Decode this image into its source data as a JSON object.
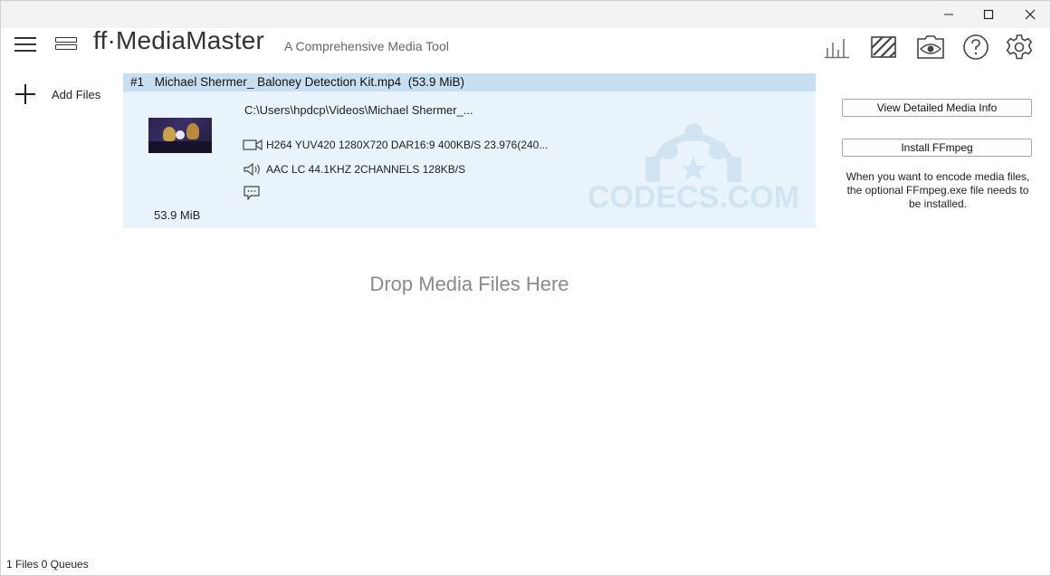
{
  "window": {
    "minimize_glyph": "—",
    "maximize_glyph": "☐",
    "close_glyph": "✕"
  },
  "header": {
    "app_title": "ff·MediaMaster",
    "app_subtitle": "A Comprehensive Media Tool",
    "icons": [
      "hamburger-menu-icon",
      "queue-stack-icon",
      "bar-chart-icon",
      "stripes-icon",
      "preview-eye-icon",
      "help-icon",
      "settings-gear-icon"
    ]
  },
  "sidebar": {
    "add_files_label": "Add Files"
  },
  "media_item": {
    "index": "#1",
    "filename": "Michael Shermer_ Baloney Detection Kit.mp4",
    "size_header": "(53.9 MiB)",
    "path": "C:\\Users\\hpdcp\\Videos\\Michael Shermer_...",
    "video_stream": "H264 YUV420 1280X720 DAR16:9 400KB/S 23.976(240...",
    "audio_stream": "AAC LC 44.1KHZ 2CHANNELS 128KB/S",
    "file_size": "53.9 MiB",
    "watermark_text": "CODECS.COM"
  },
  "right_panel": {
    "view_info_label": "View Detailed Media Info",
    "install_ffmpeg_label": "Install FFmpeg",
    "ffmpeg_note": "When you want to encode media files, the optional FFmpeg.exe file needs to be installed."
  },
  "drop_zone": {
    "text": "Drop Media Files Here"
  },
  "status_bar": {
    "text": "1 Files 0 Queues"
  },
  "colors": {
    "item_bg": "#e8f3fb",
    "item_header_bg": "#c7dff1",
    "watermark": "#d2e4f1"
  }
}
